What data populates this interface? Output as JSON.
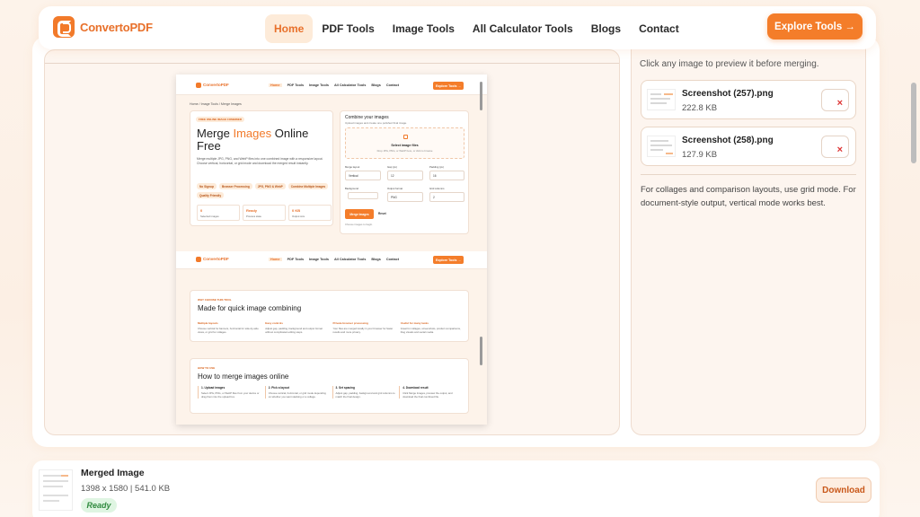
{
  "nav": {
    "brand": "ConvertoPDF",
    "menu": [
      "Home",
      "PDF Tools",
      "Image Tools",
      "All Calculator Tools",
      "Blogs",
      "Contact"
    ],
    "active_index": 0,
    "cta": "Explore Tools →"
  },
  "sidebar": {
    "hint": "Click any image to preview it before merging.",
    "files": [
      {
        "name": "Screenshot (257).png",
        "size": "222.8 KB",
        "remove": "×"
      },
      {
        "name": "Screenshot (258).png",
        "size": "127.9 KB",
        "remove": "×"
      }
    ],
    "tip": "For collages and comparison layouts, use grid mode. For document-style output, vertical mode works best."
  },
  "result": {
    "title": "Merged Image",
    "meta": "1398 x 1580 | 541.0 KB",
    "status": "Ready",
    "download": "Download"
  },
  "preview": {
    "brand": "ConvertoPDF",
    "menu": [
      "Home",
      "PDF Tools",
      "Image Tools",
      "All Calculator Tools",
      "Blogs",
      "Contact"
    ],
    "cta": "Explore Tools →",
    "breadcrumb": "Home / Image Tools / Merge Images",
    "tag": "FREE ONLINE IMAGE COMBINER",
    "heading_pre": "Merge ",
    "heading_accent": "Images",
    "heading_post": " Online Free",
    "intro": "Merge multiple JPG, PNG, and WebP files into one combined image with a responsive layout. Choose vertical, horizontal, or grid mode and download the merged result instantly.",
    "chips": [
      "No Signup",
      "Browser Processing",
      "JPG, PNG & WebP",
      "Combine Multiple Images",
      "Quality Friendly"
    ],
    "stats": [
      {
        "value": "0",
        "label": "Selected images"
      },
      {
        "value": "Ready",
        "label": "Process state"
      },
      {
        "value": "0 KB",
        "label": "Output size"
      }
    ],
    "panel_title": "Combine your images",
    "panel_sub": "Upload images and create one polished final image.",
    "drop_title": "Select image files",
    "drop_sub": "Drop JPG, PNG, or WebP here, or click to browse",
    "fields": [
      {
        "label": "Merge layout",
        "value": "Vertical"
      },
      {
        "label": "Gap (px)",
        "value": "12"
      },
      {
        "label": "Padding (px)",
        "value": "16"
      },
      {
        "label": "Background",
        "value": ""
      },
      {
        "label": "Output format",
        "value": "PNG"
      },
      {
        "label": "Grid columns",
        "value": "2"
      }
    ],
    "merge_btn": "Merge Images",
    "reset_btn": "Reset",
    "note": "Choose images to begin.",
    "why_kicker": "WHY CHOOSE THIS TOOL",
    "why_title": "Made for quick image combining",
    "why_cols": [
      {
        "title": "Multiple layouts",
        "text": "Choose vertical for banners, horizontal for side-by-side views, or grid for collages."
      },
      {
        "title": "Easy controls",
        "text": "Adjust gap, padding, background and output format without complicated editing steps."
      },
      {
        "title": "Private browser processing",
        "text": "Your files are merged locally in your browser for faster results and more privacy."
      },
      {
        "title": "Useful for many tasks",
        "text": "Great for collages, screenshots, product comparisons, blog visuals and social media."
      }
    ],
    "how_kicker": "HOW TO USE",
    "how_title": "How to merge images online",
    "how_steps": [
      {
        "title": "1. Upload images",
        "text": "Select JPG, PNG, or WebP files from your device or drag them into the upload box."
      },
      {
        "title": "2. Pick a layout",
        "text": "Choose vertical, horizontal, or grid mode depending on whether you want stacking or a collage."
      },
      {
        "title": "3. Set spacing",
        "text": "Adjust gap, padding, background and grid columns to match the final design."
      },
      {
        "title": "4. Download result",
        "text": "Click Merge Images, preview the output, and download the final combined file."
      }
    ]
  },
  "colors": {
    "accent": "#f47d2a",
    "bg": "#fdf3ea",
    "ready_bg": "#dff5e2",
    "ready_text": "#2f8a3e"
  }
}
